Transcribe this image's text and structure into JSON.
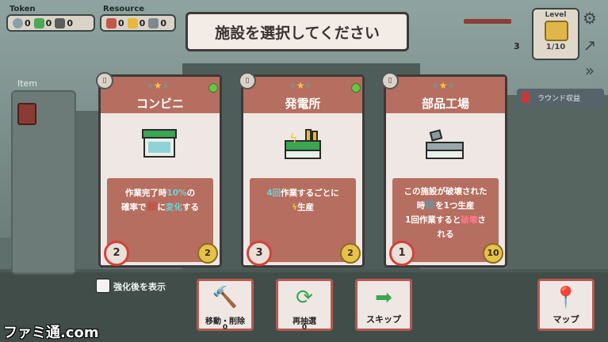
{
  "hud": {
    "token_label": "Token",
    "resource_label": "Resource",
    "tokens": [
      "0",
      "0",
      "0"
    ],
    "resources": [
      "0",
      "0",
      "0"
    ],
    "badge_count": "3"
  },
  "item_panel": {
    "label": "Item"
  },
  "level": {
    "label": "Level",
    "value": "1/10"
  },
  "round_income": {
    "label": "ラウンド収益"
  },
  "title": "施設を選択してください",
  "cards": [
    {
      "name": "コンビニ",
      "stars": [
        false,
        true,
        false
      ],
      "icon": "convenience-store-icon",
      "desc_parts": [
        "作業完了時",
        "10%",
        "の",
        "確率で",
        "[gift]",
        "に",
        "変化",
        "する"
      ],
      "cost_red": "2",
      "cost_gold": "2"
    },
    {
      "name": "発電所",
      "stars": [
        false,
        true,
        false
      ],
      "icon": "power-plant-icon",
      "desc_parts": [
        "4回",
        "作業するごとに",
        "[bolt]",
        "生産"
      ],
      "cost_red": "3",
      "cost_gold": "2"
    },
    {
      "name": "部品工場",
      "stars": [
        false,
        true,
        false
      ],
      "icon": "parts-factory-icon",
      "desc_parts": [
        "この施設が破壊された",
        "時",
        "[wrench]",
        "を1つ生産",
        "1回作業すると",
        "破壊",
        "さ",
        "れる"
      ],
      "cost_red": "1",
      "cost_gold": "10"
    }
  ],
  "show_upgrade_label": "強化後を表示",
  "buttons": {
    "move_label": "移動・削除",
    "move_count": "0",
    "reroll_label": "再抽選",
    "reroll_count": "0",
    "skip_label": "スキップ",
    "map_label": "マップ"
  },
  "watermark": "ファミ通.com",
  "colors": {
    "card_header": "#b56e5f",
    "highlight": "#6fd2d8",
    "destroy": "#ff7a8e",
    "button_border": "#b25a50"
  }
}
